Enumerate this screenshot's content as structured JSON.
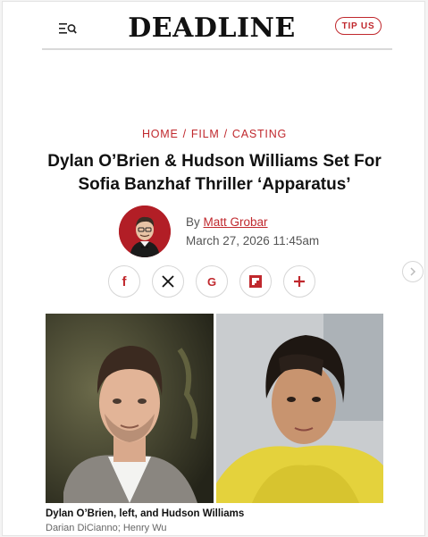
{
  "header": {
    "logo": "DEADLINE",
    "tip_button": "TIP US",
    "menu_icon": "menu-search-icon"
  },
  "breadcrumb": [
    "HOME",
    "FILM",
    "CASTING"
  ],
  "article": {
    "headline": "Dylan O’Brien & Hudson Williams Set For Sofia Banzhaf Thriller ‘Apparatus’",
    "byline_prefix": "By",
    "author": "Matt Grobar",
    "date": "March 27, 2026 11:45am"
  },
  "share": {
    "icons": [
      "facebook-icon",
      "x-icon",
      "google-icon",
      "flipboard-icon",
      "plus-icon"
    ],
    "labels": {
      "facebook": "f",
      "google": "G"
    }
  },
  "colors": {
    "accent": "#c0282d",
    "text": "#111111"
  },
  "image": {
    "caption": "Dylan O’Brien, left, and Hudson Williams",
    "credit": "Darian DiCianno; Henry Wu"
  }
}
